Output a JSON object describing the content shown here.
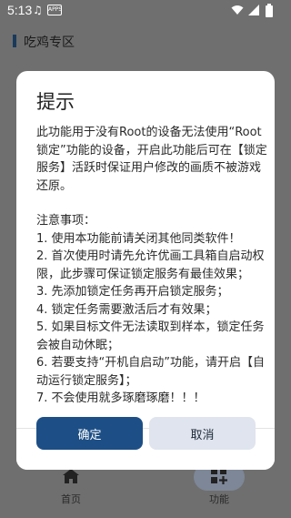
{
  "status_bar": {
    "time": "5:13",
    "app_icon_text": "APPS"
  },
  "header": {
    "title": "吃鸡专区"
  },
  "dialog": {
    "title": "提示",
    "intro": "此功能用于没有Root的设备无法使用“Root锁定”功能的设备，开启此功能后可在【锁定服务】活跃时保证用户修改的画质不被游戏还原。",
    "notes_heading": "注意事项：",
    "notes": [
      "1. 使用本功能前请关闭其他同类软件！",
      "2. 首次使用时请先允许优画工具箱自启动权限，此步骤可保证锁定服务有最佳效果；",
      "3. 先添加锁定任务再开启锁定服务；",
      "4. 锁定任务需要激活后才有效果；",
      "5. 如果目标文件无法读取到样本，锁定任务会被自动休眠；",
      "6. 若要支持“开机自启动”功能，请开启【自动运行锁定服务】；",
      "7. 不会使用就多琢磨琢磨！！！"
    ],
    "confirm_label": "确定",
    "cancel_label": "取消"
  },
  "bottom_nav": {
    "items": [
      {
        "label": "首页",
        "icon": "home-icon"
      },
      {
        "label": "功能",
        "icon": "apps-add-icon",
        "selected": true
      }
    ]
  },
  "colors": {
    "primary": "#1d4f86",
    "secondary_button": "#dfe4ee",
    "scrim": "#6f6f6f"
  }
}
